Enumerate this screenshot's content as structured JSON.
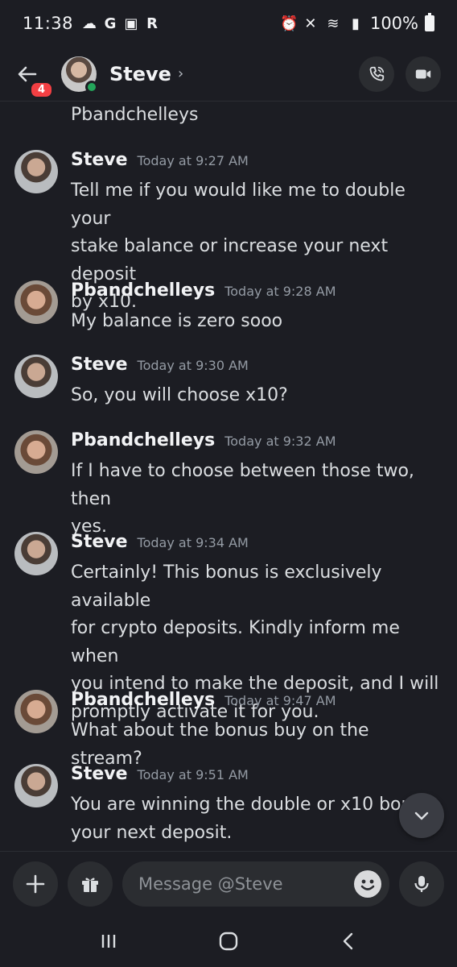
{
  "status_bar": {
    "time": "11:38",
    "left_icons": [
      "cloud-icon",
      "google-icon",
      "gallery-icon",
      "r-app-icon"
    ],
    "battery": "100%"
  },
  "header": {
    "badge_count": "4",
    "contact_name": "Steve",
    "chevron": "›"
  },
  "messages": {
    "continued_text": "Pbandchelleys",
    "items": [
      {
        "author": "Steve",
        "time": "Today at 9:27 AM",
        "lines": [
          "Tell me if you would like me to double your",
          "stake balance or increase your next deposit",
          "by x10."
        ]
      },
      {
        "author": "Pbandchelleys",
        "time": "Today at 9:28 AM",
        "lines": [
          "My balance is zero sooo"
        ]
      },
      {
        "author": "Steve",
        "time": "Today at 9:30 AM",
        "lines": [
          "So, you will choose x10?"
        ]
      },
      {
        "author": "Pbandchelleys",
        "time": "Today at 9:32 AM",
        "lines": [
          "If I have to choose between those two, then",
          "yes."
        ]
      },
      {
        "author": "Steve",
        "time": "Today at 9:34 AM",
        "lines": [
          "Certainly! This bonus is exclusively available",
          "for crypto deposits. Kindly inform me when",
          "you intend to make the deposit, and I will",
          "promptly activate it for you."
        ]
      },
      {
        "author": "Pbandchelleys",
        "time": "Today at 9:47 AM",
        "lines": [
          "What about the bonus buy on the stream?"
        ]
      },
      {
        "author": "Steve",
        "time": "Today at 9:51 AM",
        "lines": [
          "You are winning the double or x10 bonus",
          "your next deposit."
        ]
      }
    ]
  },
  "composer": {
    "placeholder": "Message @Steve"
  },
  "colors": {
    "background": "#1c1d23",
    "badge": "#f23f43",
    "online": "#23a55a",
    "timestamp": "#949ba4"
  }
}
